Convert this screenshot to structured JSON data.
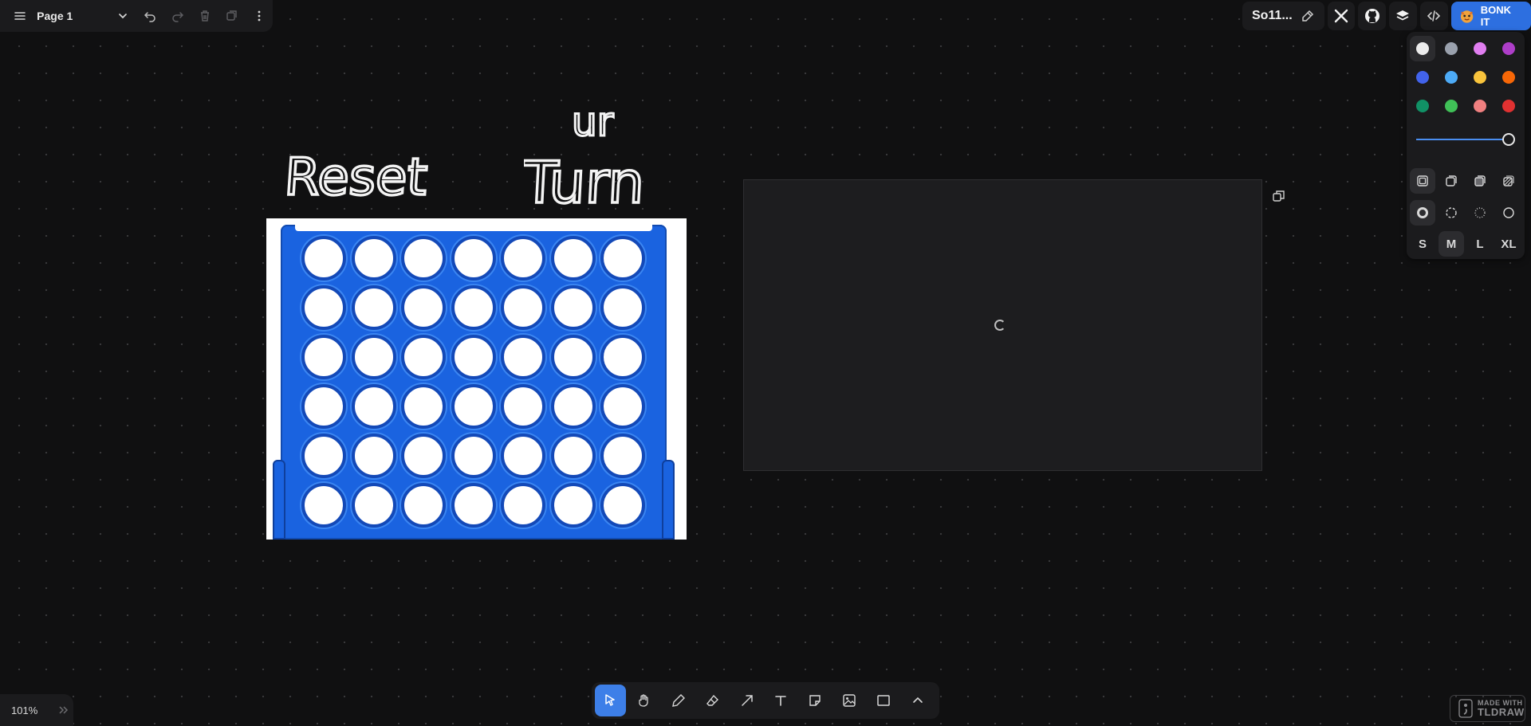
{
  "menu": {
    "page_name": "Page 1",
    "icons": [
      "hamburger-menu-icon",
      "chevron-down-icon",
      "undo-icon",
      "redo-icon",
      "trash-icon",
      "duplicate-icon",
      "more-vertical-icon"
    ]
  },
  "share": {
    "doc_name": "So11...",
    "bonk_label": "BONK IT",
    "icons": [
      "pencil-icon",
      "x-logo-icon",
      "github-icon",
      "layers-icon",
      "code-icon",
      "bonk-dog-icon"
    ]
  },
  "canvas": {
    "reset_text": "Reset",
    "ur_text": "ur",
    "turn_text": "Turn",
    "board": {
      "rows": 6,
      "columns": 7
    }
  },
  "style_panel": {
    "colors": [
      "#ececec",
      "#9aa1ad",
      "#e07ef0",
      "#ae3ec9",
      "#4263eb",
      "#4dabf7",
      "#f9c43c",
      "#f76707",
      "#119166",
      "#40c057",
      "#f08080",
      "#e03131"
    ],
    "selected_color": "#ececec",
    "opacity": 1.0,
    "sizes": [
      "S",
      "M",
      "L",
      "XL"
    ],
    "selected_size": "M"
  },
  "toolbar": {
    "tools": [
      "select-tool",
      "hand-tool",
      "draw-tool",
      "eraser-tool",
      "arrow-tool",
      "text-tool",
      "note-tool",
      "asset-tool",
      "rectangle-tool",
      "more-tools"
    ],
    "active_tool": "select-tool"
  },
  "footer": {
    "zoom": "101%",
    "made_with": "MADE WITH",
    "brand": "TLDRAW"
  }
}
